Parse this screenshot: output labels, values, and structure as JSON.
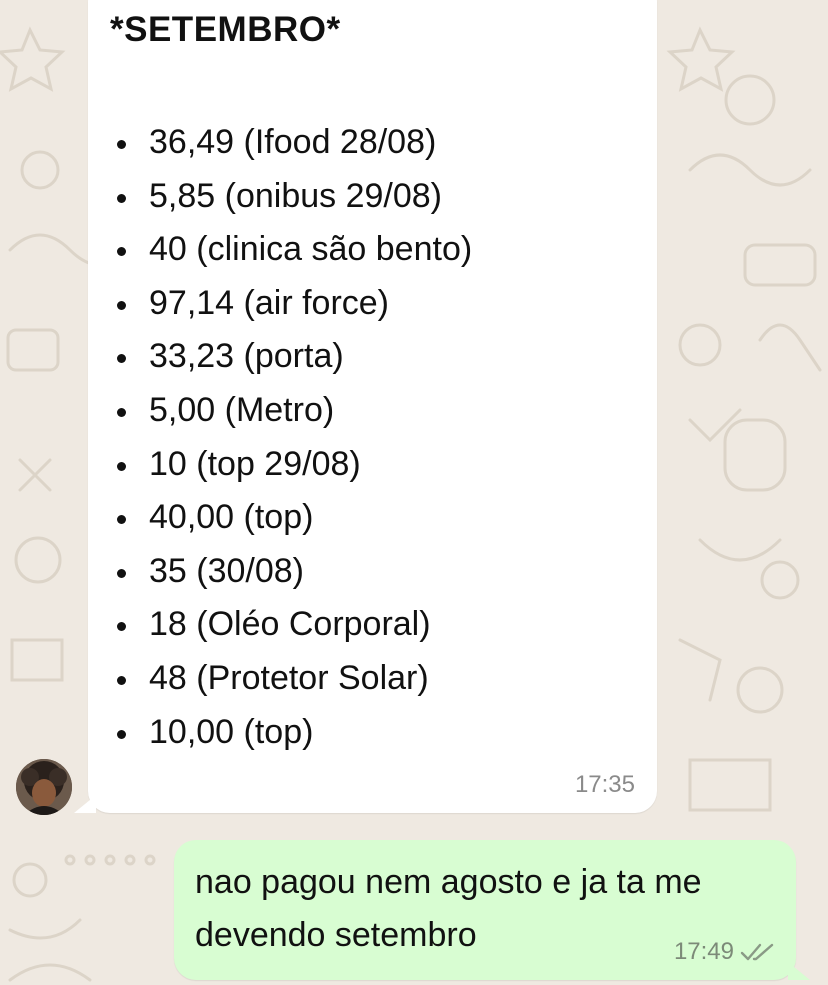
{
  "incoming_message": {
    "title": "*SETEMBRO*",
    "items": [
      "36,49 (Ifood 28/08)",
      "5,85 (onibus 29/08)",
      "40 (clinica são bento)",
      "97,14 (air force)",
      "33,23 (porta)",
      "5,00 (Metro)",
      "10 (top 29/08)",
      "40,00 (top)",
      "35 (30/08)",
      "18 (Oléo Corporal)",
      "48 (Protetor Solar)",
      "10,00 (top)"
    ],
    "time": "17:35"
  },
  "outgoing_message": {
    "text": "nao pagou nem agosto e ja ta me devendo setembro",
    "time": "17:49",
    "status_icon": "double-check-icon"
  },
  "colors": {
    "chat_background": "#efe9e1",
    "incoming_bubble": "#ffffff",
    "outgoing_bubble": "#d8fdd2",
    "read_check": "#8a9a86"
  }
}
